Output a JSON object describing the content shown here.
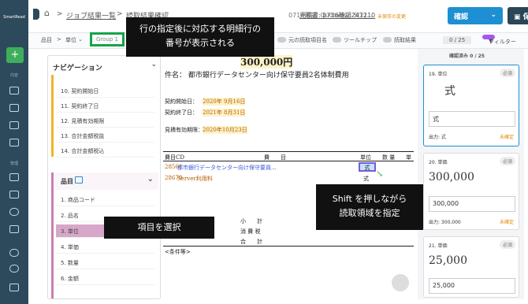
{
  "rail": {
    "logo": "SmartRead",
    "plus": "+",
    "section1": "内容",
    "section2": "管理"
  },
  "breadcrumb": {
    "home": "⌂",
    "sep": ">",
    "parent": "ジョブ結果一覧",
    "current": "読取結果確認",
    "doc_id": "0714確認_Quotation 5(2)...",
    "file": "見積書: 0716確認241210",
    "unsaved": "未保存の変更"
  },
  "buttons": {
    "confirm": "確認",
    "save": "保存"
  },
  "subbar": {
    "item": "品目",
    "unit": "単位",
    "group": "Group 1",
    "rawname": "元の読取項目名",
    "tooltip": "ツールチップ",
    "result": "読取結果",
    "count": "0 / 25",
    "filter": "フィルター"
  },
  "nav": {
    "title": "ナビゲーション",
    "items": [
      "10. 契約開始日",
      "11. 契約終了日",
      "12. 見積有効期限",
      "13. 合計金額税抜",
      "14. 合計金額税込"
    ],
    "group_title": "品目",
    "group_items": [
      "1. 商品コード",
      "2. 品名",
      "3. 単位",
      "4. 単価",
      "5. 数量",
      "6. 金額"
    ]
  },
  "doc": {
    "amount": "300,000円",
    "subject": "件名： 都市銀行データセンター向け保守要員2名体制費用",
    "start_label": "契約開始日：",
    "start": "2020年 9月16日",
    "end_label": "契約終了日：",
    "end": "2021年 8月31日",
    "valid_label": "見積有効期限：",
    "valid": "2020年10月23日",
    "h_code": "費目CD",
    "h_item": "費　　目",
    "h_unit": "単位",
    "h_qty": "数 量",
    "h_price": "単",
    "r1_code": "28561",
    "r1_name": "都市銀行データセンター向け保守要員...",
    "r1_unit": "式",
    "r2_code": "28679",
    "r2_name": "Server利用料",
    "r2_unit": "式",
    "sub": "小　　計",
    "tax": "消 費 税",
    "total": "合　　計",
    "cond": "<条件等>"
  },
  "right": {
    "header": "確認済み 0 / 25",
    "cards": [
      {
        "title": "19. 単位",
        "badge": "必須",
        "big": "式",
        "value": "式",
        "out": "出力: 式",
        "status": "未確定"
      },
      {
        "title": "20. 単価",
        "badge": "必須",
        "big": "300,000",
        "value": "300,000",
        "out": "出力: 300,000",
        "status": "未確定"
      },
      {
        "title": "21. 単価",
        "badge": "必須",
        "big": "25,000",
        "value": "25,000"
      }
    ]
  },
  "overlays": {
    "top": "行の指定後に対応する明細行の\n番号が表示される",
    "right": "Shift を押しながら\n読取領域を指定",
    "bottom": "項目を選択"
  },
  "colors": {
    "accent": "#1e8fd2",
    "green": "#17a34a",
    "purple": "#a855f7",
    "pink": "#c97fb1",
    "orange": "#f0b429"
  }
}
